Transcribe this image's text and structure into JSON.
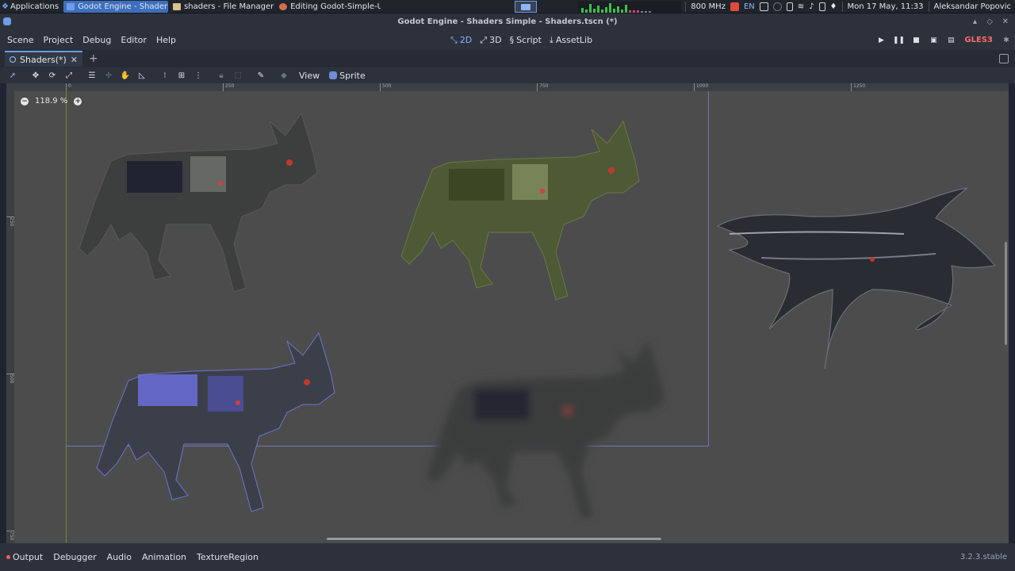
{
  "os": {
    "apps_label": "Applications",
    "tasks": [
      {
        "label": "Godot Engine - Shaders ...",
        "active": true,
        "color": "#6f9bea"
      },
      {
        "label": "shaders - File Manager",
        "active": false,
        "color": "#d8c48a"
      },
      {
        "label": "Editing Godot-Simple-U...",
        "active": false,
        "color": "#d66b4c"
      }
    ],
    "cpu_freq": "800 MHz",
    "lang": "EN",
    "datetime": "Mon 17 May, 11:33",
    "user": "Aleksandar Popovic"
  },
  "window": {
    "title": "Godot Engine - Shaders Simple - Shaders.tscn (*)"
  },
  "menu": {
    "items": [
      "Scene",
      "Project",
      "Debug",
      "Editor",
      "Help"
    ],
    "workspaces": [
      {
        "label": "2D",
        "active": true
      },
      {
        "label": "3D",
        "active": false
      },
      {
        "label": "Script",
        "active": false
      },
      {
        "label": "AssetLib",
        "active": false
      }
    ],
    "renderer": "GLES3"
  },
  "scene_tab": {
    "label": "Shaders(*)",
    "close": "✕",
    "add": "+"
  },
  "toolbar": {
    "view_label": "View",
    "sprite_label": "Sprite"
  },
  "viewport": {
    "zoom_label": "118.9 %",
    "zoom_out": "−",
    "zoom_in": "+",
    "ruler_top": [
      "0",
      "250",
      "500",
      "750",
      "1000",
      "1250"
    ],
    "ruler_left": [
      "250",
      "500",
      "750"
    ]
  },
  "bottom": {
    "tabs": [
      "Output",
      "Debugger",
      "Audio",
      "Animation",
      "TextureRegion"
    ],
    "version": "3.2.3.stable"
  },
  "colors": {
    "accent": "#6f9bea",
    "viewport_bg": "#4c4c4c",
    "renderer": "#ff6a6a"
  }
}
